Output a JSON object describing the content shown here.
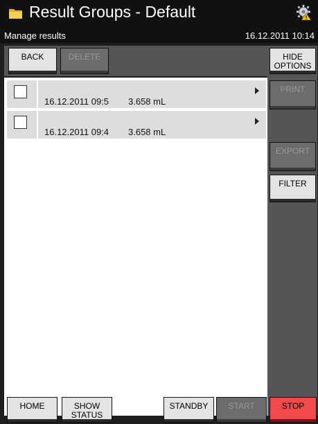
{
  "header": {
    "title": "Result Groups - Default",
    "subtitle": "Manage results",
    "datetime": "16.12.2011 10:14",
    "folder_icon": "folder-icon",
    "gear_icon": "gear-icon"
  },
  "toolbar": {
    "back": "BACK",
    "delete": "DELETE",
    "hide_options": "HIDE OPTIONS"
  },
  "side": {
    "print": "PRINT",
    "export": "EXPORT",
    "filter": "FILTER"
  },
  "results": [
    {
      "date": "16.12.2011 09:5",
      "value": "3.658 mL"
    },
    {
      "date": "16.12.2011 09:4",
      "value": "3.658 mL"
    }
  ],
  "bottom": {
    "home": "HOME",
    "show_status": "SHOW STATUS",
    "standby": "STANDBY",
    "start": "START",
    "stop": "STOP"
  },
  "colors": {
    "stop": "#f04a4a",
    "disabled": "#6c6c6c",
    "panel": "#555555"
  }
}
